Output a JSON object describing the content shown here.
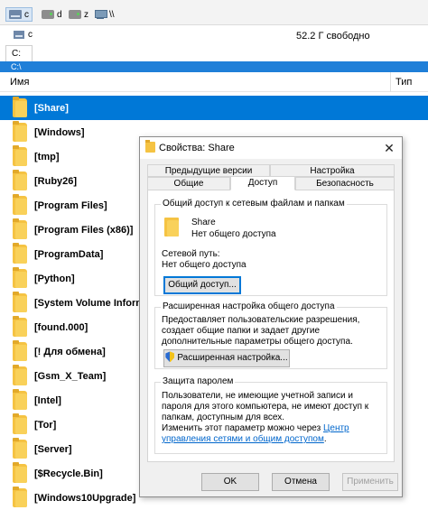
{
  "drives": [
    {
      "letter": "c",
      "active": true
    },
    {
      "letter": "d",
      "active": false
    },
    {
      "letter": "z",
      "active": false
    },
    {
      "letter": "\\\\",
      "active": false
    }
  ],
  "current_drive": "c",
  "free_space": "52.2 Г свободно",
  "path_tab": "C:",
  "path": "C:\\",
  "columns": {
    "name": "Имя",
    "type": "Тип"
  },
  "files": [
    "[Share]",
    "[Windows]",
    "[tmp]",
    "[Ruby26]",
    "[Program Files]",
    "[Program Files (x86)]",
    "[ProgramData]",
    "[Python]",
    "[System Volume Information]",
    "[found.000]",
    "[! Для обмена]",
    "[Gsm_X_Team]",
    "[Intel]",
    "[Tor]",
    "[Server]",
    "[$Recycle.Bin]",
    "[Windows10Upgrade]"
  ],
  "selected_file": "[Share]",
  "dialog": {
    "title": "Свойства: Share",
    "close_glyph": "✕",
    "tabs_row1": [
      "Предыдущие версии",
      "Настройка"
    ],
    "tabs_row2": [
      "Общие",
      "Доступ",
      "Безопасность"
    ],
    "active_tab": "Доступ",
    "share_group": {
      "title": "Общий доступ к сетевым файлам и папкам",
      "name": "Share",
      "status": "Нет общего доступа",
      "path_label": "Сетевой путь:",
      "path_value": "Нет общего доступа",
      "button": "Общий доступ..."
    },
    "advanced_group": {
      "title": "Расширенная настройка общего доступа",
      "description": "Предоставляет пользовательские разрешения, создает общие папки и задает другие дополнительные параметры общего доступа.",
      "button": "Расширенная настройка..."
    },
    "password_group": {
      "title": "Защита паролем",
      "description": "Пользователи, не имеющие учетной записи и пароля для этого компьютера, не имеют доступ к папкам, доступным для всех.",
      "change_text": "Изменить этот параметр можно через",
      "link": "Центр управления сетями и общим доступом",
      "link_tail": "."
    },
    "ok": "OK",
    "cancel": "Отмена",
    "apply": "Применить"
  }
}
